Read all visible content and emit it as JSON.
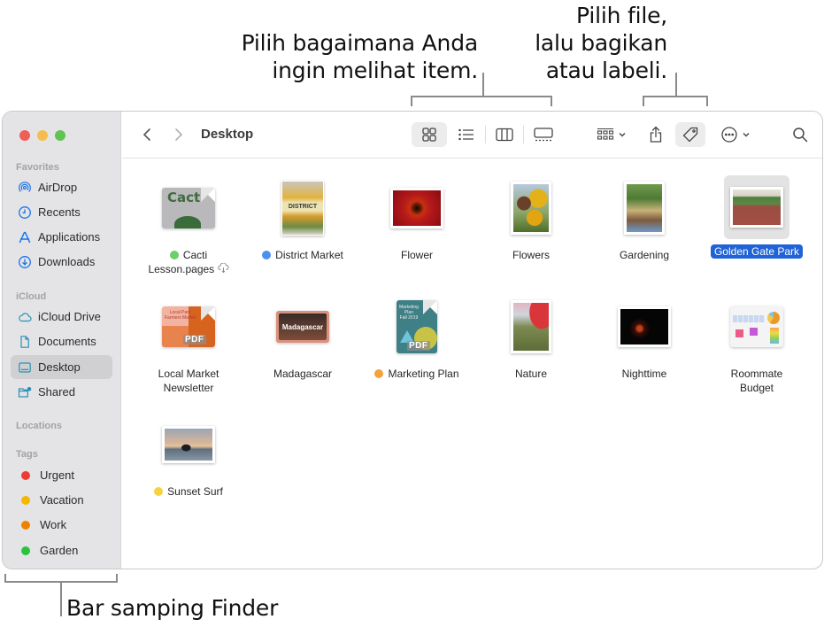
{
  "callouts": {
    "view_options": [
      "Pilih bagaimana Anda",
      "ingin melihat item."
    ],
    "share_tag": [
      "Pilih file,",
      "lalu bagikan",
      "atau labeli."
    ],
    "sidebar": "Bar samping Finder"
  },
  "window": {
    "traffic_lights": {
      "close": "#ee5f57",
      "minimize": "#f5bd4f",
      "zoom": "#5fc454"
    }
  },
  "sidebar": {
    "sections": {
      "favorites": "Favorites",
      "icloud": "iCloud",
      "locations": "Locations",
      "tags": "Tags"
    },
    "favorites": [
      {
        "label": "AirDrop",
        "icon": "airdrop-icon"
      },
      {
        "label": "Recents",
        "icon": "clock-icon"
      },
      {
        "label": "Applications",
        "icon": "applications-icon"
      },
      {
        "label": "Downloads",
        "icon": "download-icon"
      }
    ],
    "icloud": [
      {
        "label": "iCloud Drive",
        "icon": "cloud-icon"
      },
      {
        "label": "Documents",
        "icon": "document-icon"
      },
      {
        "label": "Desktop",
        "icon": "desktop-icon",
        "active": true
      },
      {
        "label": "Shared",
        "icon": "shared-folder-icon"
      }
    ],
    "tags": [
      {
        "label": "Urgent",
        "color": "#f03a36"
      },
      {
        "label": "Vacation",
        "color": "#f2b800"
      },
      {
        "label": "Work",
        "color": "#ee8200"
      },
      {
        "label": "Garden",
        "color": "#2ac33c"
      }
    ]
  },
  "toolbar": {
    "title": "Desktop",
    "view_mode_selected": "icon"
  },
  "files": [
    {
      "name_lines": [
        "Cacti",
        "Lesson.pages"
      ],
      "tag_color": "#6ccf68",
      "cloud": true
    },
    {
      "name_lines": [
        "District Market"
      ],
      "tag_color": "#4d8ff0"
    },
    {
      "name_lines": [
        "Flower"
      ]
    },
    {
      "name_lines": [
        "Flowers"
      ]
    },
    {
      "name_lines": [
        "Gardening"
      ]
    },
    {
      "name_lines": [
        "Golden Gate Park"
      ],
      "selected": true
    },
    {
      "name_lines": [
        "Local Market",
        "Newsletter"
      ]
    },
    {
      "name_lines": [
        "Madagascar"
      ]
    },
    {
      "name_lines": [
        "Marketing Plan"
      ],
      "tag_color": "#f2a33c"
    },
    {
      "name_lines": [
        "Nature"
      ]
    },
    {
      "name_lines": [
        "Nighttime"
      ]
    },
    {
      "name_lines": [
        "Roommate",
        "Budget"
      ]
    },
    {
      "name_lines": [
        "Sunset Surf"
      ],
      "tag_color": "#f7d240"
    }
  ],
  "thumb_text": {
    "cacti": "Cact",
    "district": "DISTRICT",
    "madagascar": "Madagascar",
    "marketing": [
      "Marketing",
      "Plan",
      "Fall 2019"
    ],
    "local_market": [
      "Local Park",
      "Farmers Market"
    ],
    "pdf": "PDF"
  }
}
